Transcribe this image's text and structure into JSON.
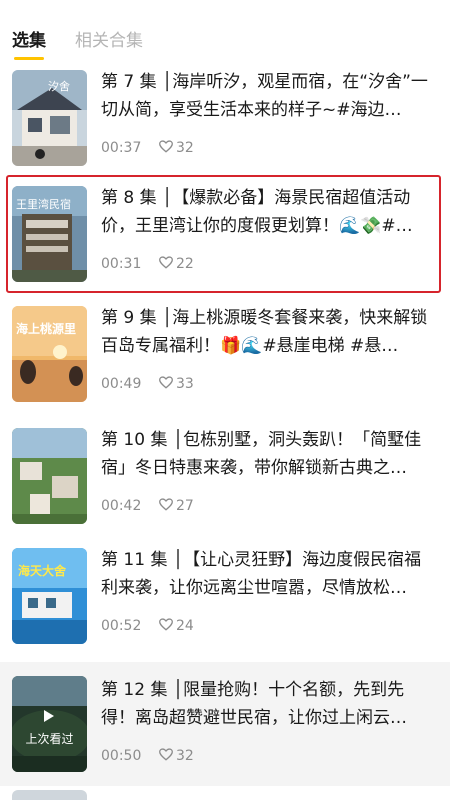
{
  "tabs": {
    "active": "选集",
    "inactive": "相关合集"
  },
  "episodes": [
    {
      "title": "第 7 集 │海岸听汐，观星而宿，在“汐舍”一切从简，享受生活本来的样子~#海边…",
      "duration": "00:37",
      "likes": "32",
      "thumb_text": "汐舍"
    },
    {
      "title": "第 8 集 │【爆款必备】海景民宿超值活动价，王里湾让你的度假更划算！🌊💸#…",
      "duration": "00:31",
      "likes": "22",
      "thumb_text": "王里湾民宿"
    },
    {
      "title": "第 9 集 │海上桃源暖冬套餐来袭，快来解锁百岛专属福利！🎁🌊#悬崖电梯 #悬…",
      "duration": "00:49",
      "likes": "33",
      "thumb_text": "海上桃源里"
    },
    {
      "title": "第 10 集 │包栋别墅，洞头轰趴！「简墅佳宿」冬日特惠来袭，带你解锁新古典之…",
      "duration": "00:42",
      "likes": "27",
      "thumb_text": ""
    },
    {
      "title": "第 11 集 │【让心灵狂野】海边度假民宿福利来袭，让你远离尘世喧嚣，尽情放松…",
      "duration": "00:52",
      "likes": "24",
      "thumb_text": "海天大舍"
    },
    {
      "title": "第 12 集 │限量抢购！十个名额，先到先得！离岛超赞避世民宿，让你过上闲云…",
      "duration": "00:50",
      "likes": "32",
      "thumb_text": "上次看过"
    }
  ],
  "colors": {
    "accent": "#ffc300",
    "highlight": "#d6242c",
    "muted": "#8c8c8c"
  }
}
